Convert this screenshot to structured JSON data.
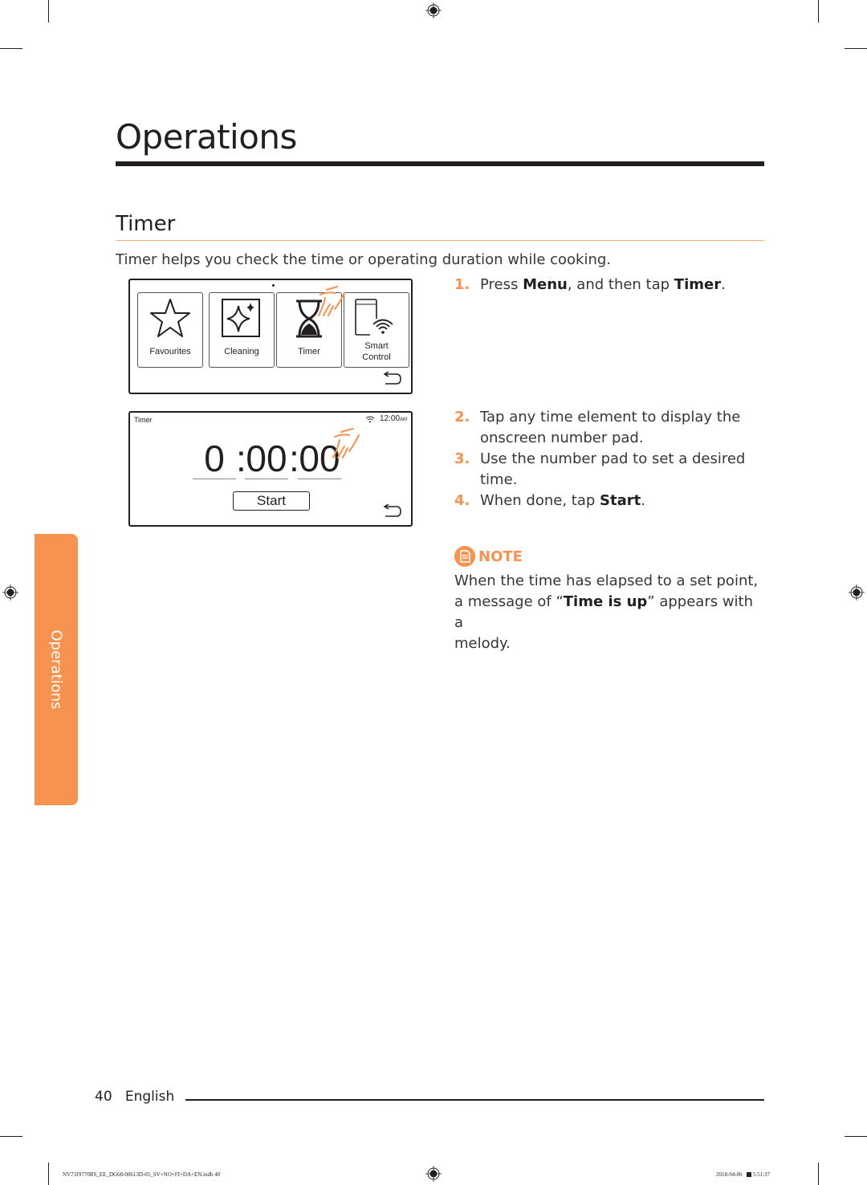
{
  "page": {
    "chapter_title": "Operations",
    "section_title": "Timer",
    "intro": "Timer helps you check the time or operating duration while cooking.",
    "side_tab": "Operations",
    "accent_color": "#f7924f"
  },
  "menu_screen": {
    "tiles": [
      {
        "label": "Favourites",
        "icon": "star-icon"
      },
      {
        "label": "Cleaning",
        "icon": "sparkle-icon"
      },
      {
        "label": "Timer",
        "icon": "hourglass-icon"
      },
      {
        "label_line1": "Smart",
        "label_line2": "Control",
        "icon": "smart-control-icon"
      }
    ],
    "back_icon": "back-arrow-icon"
  },
  "timer_screen": {
    "title": "Timer",
    "clock": "12:00",
    "clock_suffix": "AM",
    "hours": "0",
    "minutes": "00",
    "seconds": "00",
    "sep": ":",
    "start_label": "Start"
  },
  "steps": [
    {
      "num": "1.",
      "pre": "Press ",
      "b1": "Menu",
      "mid": ", and then tap ",
      "b2": "Timer",
      "post": "."
    },
    {
      "num": "2.",
      "line1": "Tap any time element to display the",
      "line2": "onscreen number pad."
    },
    {
      "num": "3.",
      "line1": "Use the number pad to set a desired",
      "line2": "time."
    },
    {
      "num": "4.",
      "pre": "When done, tap ",
      "b1": "Start",
      "post": "."
    }
  ],
  "note": {
    "heading": "NOTE",
    "line1": "When the time has elapsed to a set point,",
    "line2_pre": "a message of “",
    "line2_bold": "Time is up",
    "line2_post": "” appears with a",
    "line3": "melody."
  },
  "footer": {
    "page_number": "40",
    "language": "English",
    "slug_file": "NV73J9770RS_EE_DG68-00613D-05_SV+NO+FI+DA+EN.indb   40",
    "slug_date": "2018-04-06",
    "slug_time": "5:51:37"
  }
}
